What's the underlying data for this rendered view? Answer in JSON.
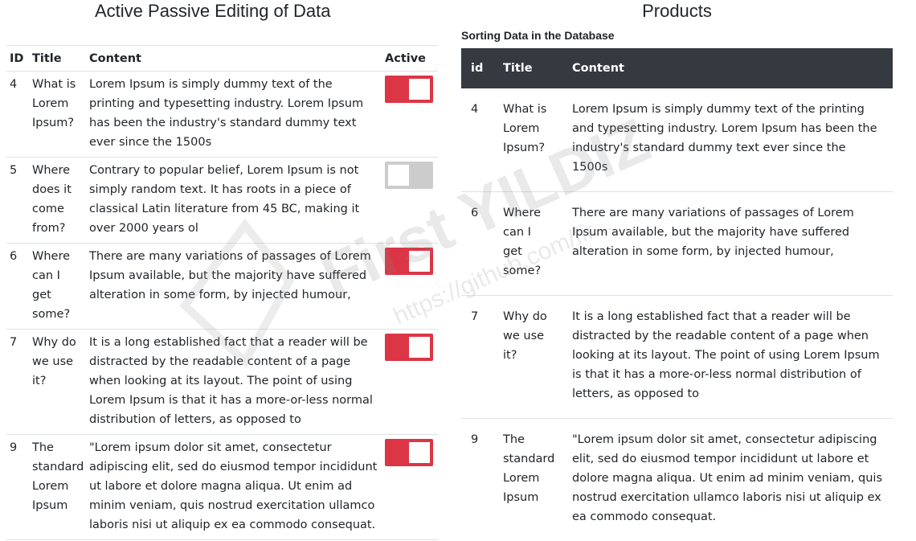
{
  "left": {
    "title": "Active Passive Editing of Data",
    "headers": {
      "id": "ID",
      "title": "Title",
      "content": "Content",
      "active": "Active"
    },
    "rows": [
      {
        "id": "4",
        "title": "What is Lorem Ipsum?",
        "content": "Lorem Ipsum is simply dummy text of the printing and typesetting industry. Lorem Ipsum has been the industry's standard dummy text ever since the 1500s",
        "active": true
      },
      {
        "id": "5",
        "title": "Where does it come from?",
        "content": "Contrary to popular belief, Lorem Ipsum is not simply random text. It has roots in a piece of classical Latin literature from 45 BC, making it over 2000 years ol",
        "active": false
      },
      {
        "id": "6",
        "title": "Where can I get some?",
        "content": "There are many variations of passages of Lorem Ipsum available, but the majority have suffered alteration in some form, by injected humour,",
        "active": true
      },
      {
        "id": "7",
        "title": "Why do we use it?",
        "content": "It is a long established fact that a reader will be distracted by the readable content of a page when looking at its layout. The point of using Lorem Ipsum is that it has a more-or-less normal distribution of letters, as opposed to",
        "active": true
      },
      {
        "id": "9",
        "title": "The standard Lorem Ipsum",
        "content": "\"Lorem ipsum dolor sit amet, consectetur adipiscing elit, sed do eiusmod tempor incididunt ut labore et dolore magna aliqua. Ut enim ad minim veniam, quis nostrud exercitation ullamco laboris nisi ut aliquip ex ea commodo consequat.",
        "active": true
      }
    ]
  },
  "right": {
    "title": "Products",
    "subtitle": "Sorting Data in the Database",
    "headers": {
      "id": "id",
      "title": "Title",
      "content": "Content"
    },
    "rows": [
      {
        "id": "4",
        "title": "What is Lorem Ipsum?",
        "content": "Lorem Ipsum is simply dummy text of the printing and typesetting industry. Lorem Ipsum has been the industry's standard dummy text ever since the 1500s"
      },
      {
        "id": "6",
        "title": "Where can I get some?",
        "content": "There are many variations of passages of Lorem Ipsum available, but the majority have suffered alteration in some form, by injected humour,"
      },
      {
        "id": "7",
        "title": "Why do we use it?",
        "content": "It is a long established fact that a reader will be distracted by the readable content of a page when looking at its layout. The point of using Lorem Ipsum is that it has a more-or-less normal distribution of letters, as opposed to"
      },
      {
        "id": "9",
        "title": "The standard Lorem Ipsum",
        "content": "\"Lorem ipsum dolor sit amet, consectetur adipiscing elit, sed do eiusmod tempor incididunt ut labore et dolore magna aliqua. Ut enim ad minim veniam, quis nostrud exercitation ullamco laboris nisi ut aliquip ex ea commodo consequat."
      }
    ]
  },
  "watermark": {
    "brand": "First YILDIZ",
    "url": "https://github.com/fir..."
  },
  "colors": {
    "toggle_on": "#dc3545",
    "toggle_off": "#cccccc",
    "header_dark": "#343a40"
  }
}
